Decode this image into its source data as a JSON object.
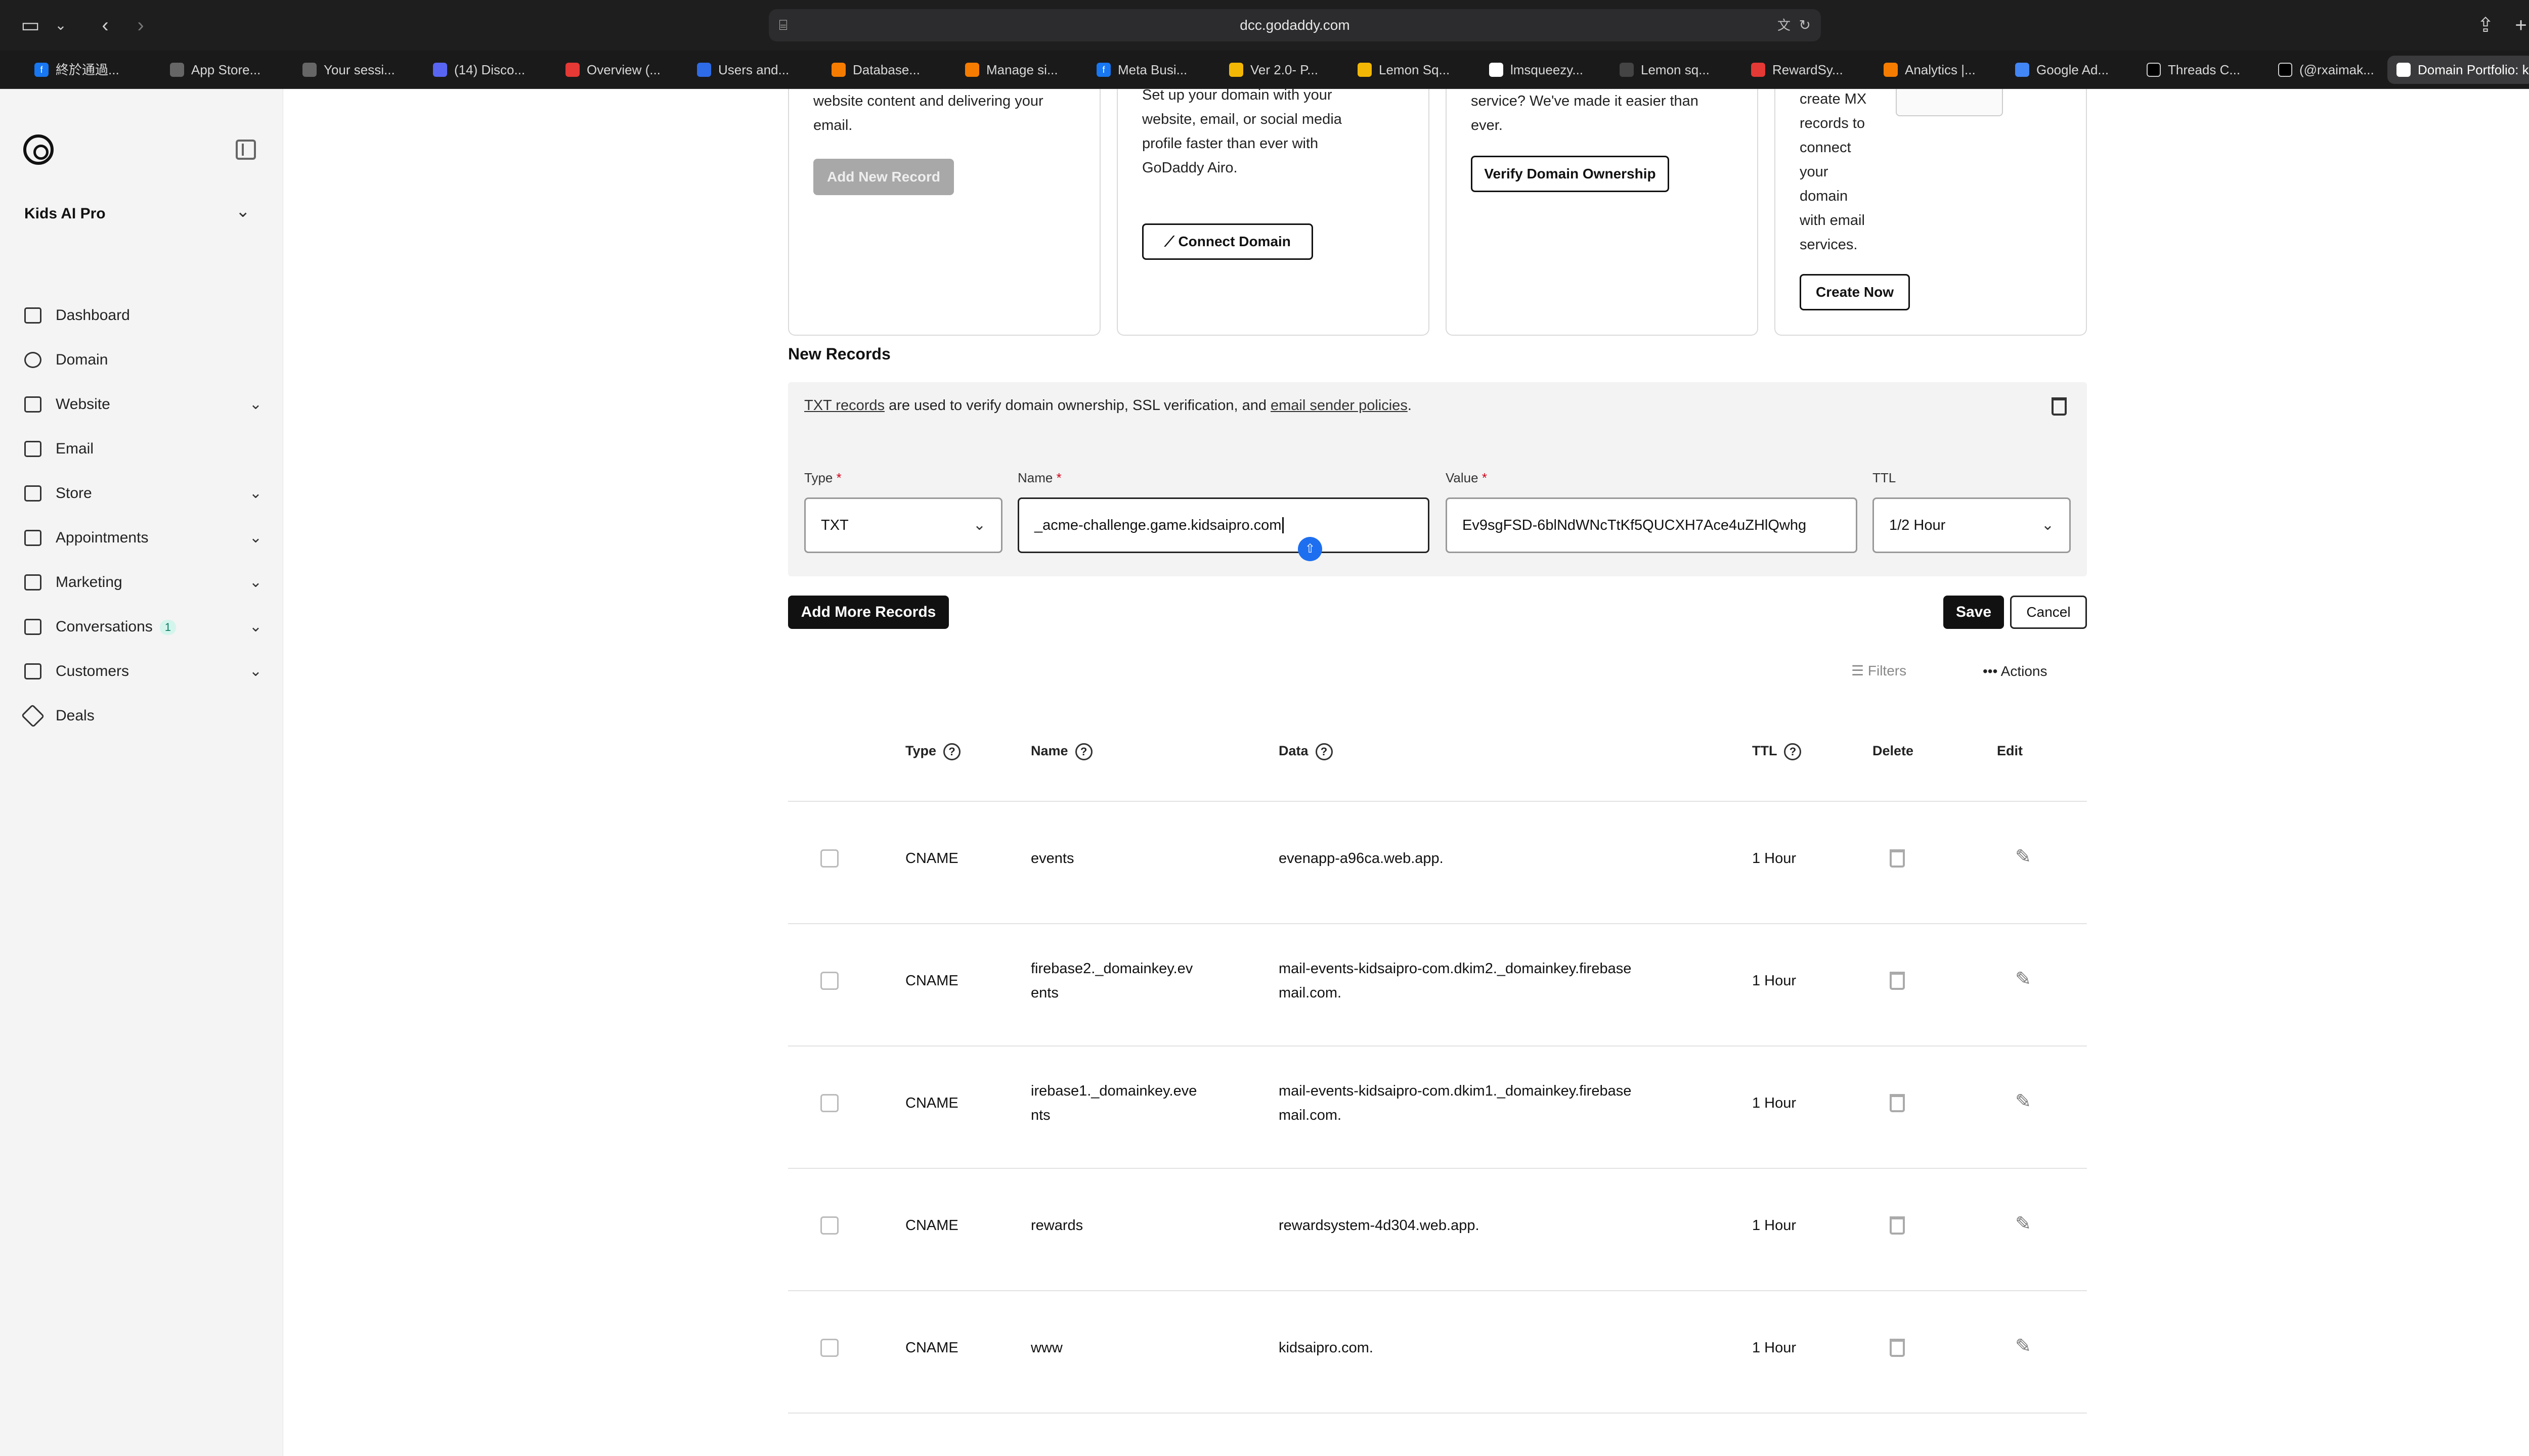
{
  "browser": {
    "url": "dcc.godaddy.com",
    "tabs": [
      {
        "label": "終於通過..."
      },
      {
        "label": "App Store..."
      },
      {
        "label": "Your sessi..."
      },
      {
        "label": "(14) Disco..."
      },
      {
        "label": "Overview (..."
      },
      {
        "label": "Users and..."
      },
      {
        "label": "Database..."
      },
      {
        "label": "Manage si..."
      },
      {
        "label": "Meta Busi..."
      },
      {
        "label": "Ver 2.0- P..."
      },
      {
        "label": "Lemon Sq..."
      },
      {
        "label": "lmsqueezy..."
      },
      {
        "label": "Lemon sq..."
      },
      {
        "label": "RewardSy..."
      },
      {
        "label": "Analytics |..."
      },
      {
        "label": "Google Ad..."
      },
      {
        "label": "Threads C..."
      },
      {
        "label": "(@rxaimak..."
      },
      {
        "label": "Domain Portfolio: kid..."
      }
    ]
  },
  "sidebar": {
    "site_name": "Kids AI Pro",
    "items": [
      {
        "label": "Dashboard"
      },
      {
        "label": "Domain"
      },
      {
        "label": "Website"
      },
      {
        "label": "Email"
      },
      {
        "label": "Store"
      },
      {
        "label": "Appointments"
      },
      {
        "label": "Marketing"
      },
      {
        "label": "Conversations",
        "badge": "1"
      },
      {
        "label": "Customers"
      },
      {
        "label": "Deals"
      }
    ]
  },
  "cards": [
    {
      "lines": [
        "website content and delivering your",
        "email."
      ],
      "button": "Add New Record"
    },
    {
      "lines": [
        "Set up your domain with your",
        "website, email, or social media",
        "profile faster than ever with",
        "GoDaddy Airo."
      ],
      "button": "Connect Domain"
    },
    {
      "lines": [
        "service? We've made it easier than",
        "ever."
      ],
      "button": "Verify Domain Ownership"
    },
    {
      "lines": [
        "create MX",
        "records to",
        "connect",
        "your",
        "domain",
        "with email",
        "services."
      ],
      "button": "Create Now"
    }
  ],
  "new_records": {
    "title": "New Records",
    "info_link_1": "TXT records",
    "info_mid": " are used to verify domain ownership, SSL verification, and ",
    "info_link_2": "email sender policies",
    "info_end": ".",
    "type_label": "Type",
    "name_label": "Name",
    "value_label": "Value",
    "ttl_label": "TTL",
    "required_mark": "*",
    "type_value": "TXT",
    "name_value": "_acme-challenge.game.kidsaipro.com",
    "value_value": "Ev9sgFSD-6blNdWNcTtKf5QUCXH7Ace4uZHlQwhg",
    "ttl_value": "1/2 Hour",
    "add_more": "Add More Records",
    "save": "Save",
    "cancel": "Cancel"
  },
  "table": {
    "filters": "Filters",
    "actions": "Actions",
    "headers": {
      "type": "Type",
      "name": "Name",
      "data": "Data",
      "ttl": "TTL",
      "delete": "Delete",
      "edit": "Edit"
    },
    "rows": [
      {
        "type": "CNAME",
        "name": [
          "events"
        ],
        "data": [
          "evenapp-a96ca.web.app."
        ],
        "ttl": "1 Hour"
      },
      {
        "type": "CNAME",
        "name": [
          "firebase2._domainkey.ev",
          "ents"
        ],
        "data": [
          "mail-events-kidsaipro-com.dkim2._domainkey.firebase",
          "mail.com."
        ],
        "ttl": "1 Hour"
      },
      {
        "type": "CNAME",
        "name": [
          "irebase1._domainkey.eve",
          "nts"
        ],
        "data": [
          "mail-events-kidsaipro-com.dkim1._domainkey.firebase",
          "mail.com."
        ],
        "ttl": "1 Hour"
      },
      {
        "type": "CNAME",
        "name": [
          "rewards"
        ],
        "data": [
          "rewardsystem-4d304.web.app."
        ],
        "ttl": "1 Hour"
      },
      {
        "type": "CNAME",
        "name": [
          "www"
        ],
        "data": [
          "kidsaipro.com."
        ],
        "ttl": "1 Hour"
      }
    ]
  }
}
